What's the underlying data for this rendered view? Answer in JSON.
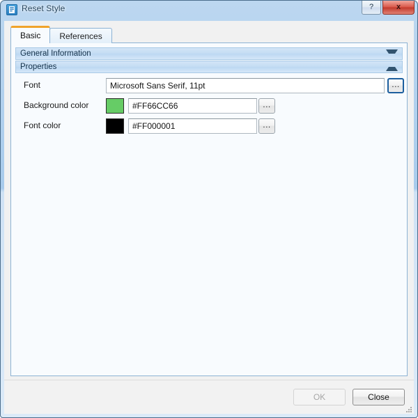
{
  "window": {
    "title": "Reset Style",
    "icon": "style-document-icon",
    "controls": {
      "help_label": "?",
      "help_icon": "help-icon",
      "close_label": "x",
      "close_icon": "close-icon"
    }
  },
  "tabs": [
    {
      "label": "Basic",
      "active": true
    },
    {
      "label": "References",
      "active": false
    }
  ],
  "groups": [
    {
      "label": "General Information",
      "expanded": false,
      "chevron": "chevron-down-icon"
    },
    {
      "label": "Properties",
      "expanded": true,
      "chevron": "chevron-up-icon"
    }
  ],
  "properties": {
    "font": {
      "label": "Font",
      "value": "Microsoft Sans Serif, 11pt",
      "browse_label": "...",
      "focused": true
    },
    "background_color": {
      "label": "Background color",
      "value": "#FF66CC66",
      "swatch_hex": "#66CC66",
      "browse_label": "..."
    },
    "font_color": {
      "label": "Font color",
      "value": "#FF000001",
      "swatch_hex": "#000001",
      "browse_label": "..."
    }
  },
  "footer": {
    "ok_label": "OK",
    "ok_enabled": false,
    "close_label": "Close",
    "close_enabled": true,
    "resize_grip": "resize-grip-icon"
  },
  "colors": {
    "accent_tab": "#F0A32A",
    "frame_border": "#4A6D8C",
    "panel_bg": "#F8FBFE",
    "group_header": "#C3DCF3"
  }
}
